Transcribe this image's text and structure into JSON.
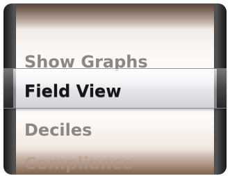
{
  "picker": {
    "items": [
      {
        "label": "Show Graphs"
      },
      {
        "label": "Field View"
      },
      {
        "label": "Deciles"
      },
      {
        "label": "Compliance"
      }
    ],
    "selected_label": "Field View"
  }
}
